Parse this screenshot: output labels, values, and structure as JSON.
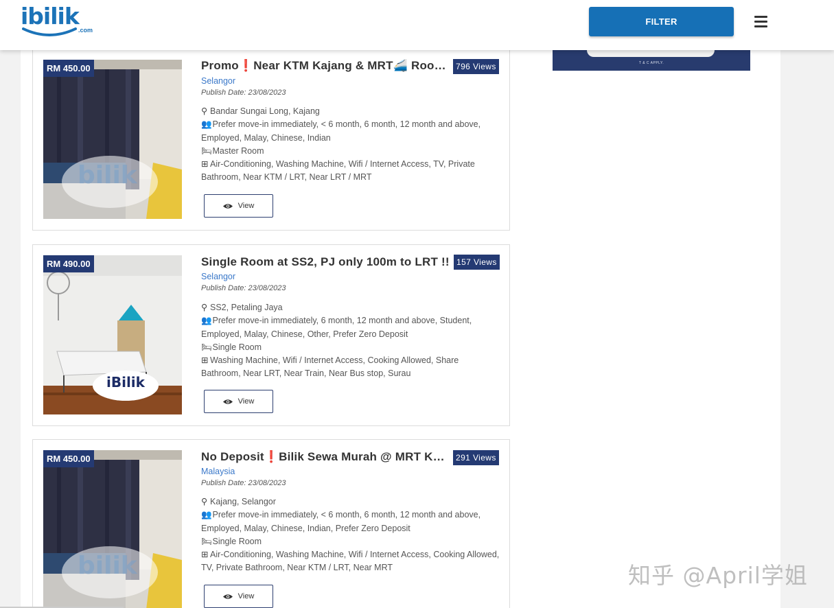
{
  "header": {
    "logo_text": "ibilik",
    "logo_suffix": ".com",
    "filter_label": "FILTER"
  },
  "banner": {
    "small_text": "T & C APPLY."
  },
  "listings": [
    {
      "price": "RM 450.00",
      "title": "Promo❗Near KTM Kajang & MRT🚄 Room Near the Station",
      "views": "796 Views",
      "state": "Selangor",
      "publish_date": "Publish Date: 23/08/2023",
      "location": "Bandar Sungai Long, Kajang",
      "preferences": "Prefer move-in immediately, < 6 month, 6 month, 12 month and above, Employed, Malay, Chinese, Indian",
      "room_type": "Master Room",
      "facilities": "Air-Conditioning, Washing Machine, Wifi / Internet Access, TV, Private Bathroom, Near KTM / LRT, Near LRT / MRT",
      "view_label": "View",
      "image_watermark": "bilik"
    },
    {
      "price": "RM 490.00",
      "title": "Single Room at SS2, PJ only 100m to LRT !!",
      "views": "157 Views",
      "state": "Selangor",
      "publish_date": "Publish Date: 23/08/2023",
      "location": "SS2, Petaling Jaya",
      "preferences": "Prefer move-in immediately, 6 month, 12 month and above, Student, Employed, Malay, Chinese, Other, Prefer Zero Deposit",
      "room_type": "Single Room",
      "facilities": "Washing Machine, Wifi / Internet Access, Cooking Allowed, Share Bathroom, Near LRT, Near Train, Near Bus stop, Surau",
      "view_label": "View",
      "image_watermark": "iBilik"
    },
    {
      "price": "RM 450.00",
      "title": "No Deposit❗Bilik Sewa Murah @ MRT Kajang",
      "views": "291 Views",
      "state": "Malaysia",
      "publish_date": "Publish Date: 23/08/2023",
      "location": "Kajang, Selangor",
      "preferences": "Prefer move-in immediately, < 6 month, 6 month, 12 month and above, Employed, Malay, Chinese, Indian, Prefer Zero Deposit",
      "room_type": "Single Room",
      "facilities": "Air-Conditioning, Washing Machine, Wifi / Internet Access, Cooking Allowed, TV, Private Bathroom, Near KTM / LRT, Near MRT",
      "view_label": "View",
      "image_watermark": "bilik"
    }
  ],
  "watermark": "知乎 @April学姐",
  "colors": {
    "brand_blue": "#1670b6",
    "badge_navy": "#243a73",
    "link_blue": "#3a78c9"
  }
}
